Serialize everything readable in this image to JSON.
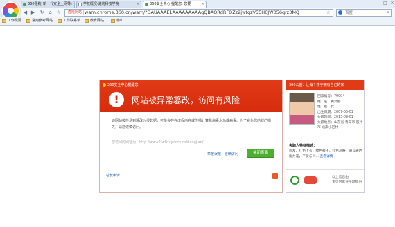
{
  "browser": {
    "tabs": [
      {
        "label": "360导航_新一代安全上网导",
        "active": false
      },
      {
        "label": "学校概况·潍坊科技学院",
        "active": false
      },
      {
        "label": "360安全中心 提醒您: 您要",
        "active": true
      }
    ],
    "new_tab_label": "+",
    "window_controls": [
      "—",
      "□",
      "×"
    ],
    "nav": {
      "back": "◀",
      "forward": "▶",
      "refresh": "↻",
      "home": "⌂",
      "star": "☆"
    },
    "url_danger_label": "危险网站",
    "url": "warn.chrome.360.cn/warn/?DAUAAAE1AAAAAAAAAgQBAQRdRFOZz2jwtqzV55H6JW056qrz3MQ",
    "search": {
      "placeholder": "百度",
      "engine_icon": "baidu-icon"
    },
    "bookmarks": [
      "工作需要",
      "常用参考网站",
      "工作联系单",
      "教育网站",
      "泰山"
    ]
  },
  "warning": {
    "logo_text": "360安全中心提醒您",
    "title": "网站被异常篡改，访问有风险",
    "description": "该网站被检测到篡改入侵数据，可能会存在虚假内容或传播计算机病毒木马或病毒。为了避免您的财产损失，请您谨慎访问。",
    "original_url": "您访问的网址为：http://www2.wfkjxy.com.cn/dangjian/",
    "report_link": "举报误报 · 继续访问",
    "close_button": "关闭页面",
    "feedback_link": "站长申诉",
    "colors": {
      "header": "#e13a16",
      "button": "#4caf2f"
    }
  },
  "charity": {
    "header": "360公益：让每个孩子拥有自己的家",
    "info": [
      "团家编号：79004",
      "姓　名：黄文静",
      "性　别：女",
      "出生日期：2007-05-01",
      "失踪时间：2013-09-01",
      "失踪地点：山东省 青岛市 胶州市 北岸小区村"
    ],
    "desc_title": "失踪人特征描述：",
    "desc": "短发，红色上衣，绿色裤子，红色凉鞋，语言表达能力差，不爱与人...",
    "more_link": "查看详情",
    "sponsor_text": "以上信息由\n宝贝回家寻子网提供"
  }
}
